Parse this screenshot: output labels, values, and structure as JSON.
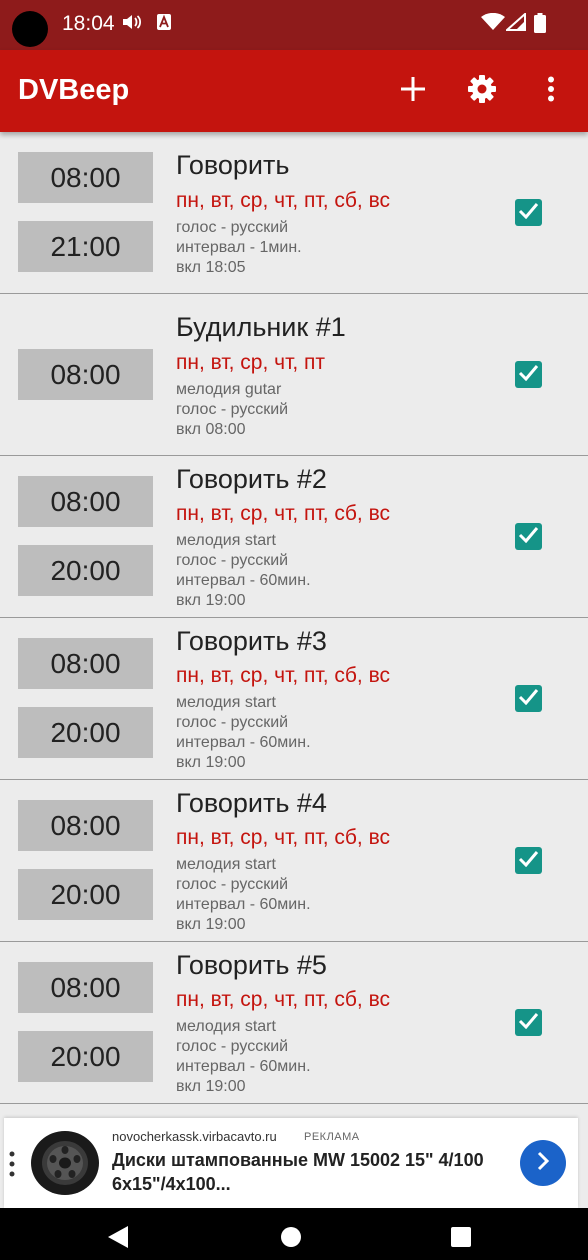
{
  "status_bar": {
    "time": "18:04",
    "icons": [
      "volume-icon",
      "notification-icon",
      "wifi-icon",
      "signal-icon",
      "battery-icon"
    ]
  },
  "app_bar": {
    "title": "DVBeep",
    "actions": [
      "add-icon",
      "settings-icon",
      "more-options-icon"
    ]
  },
  "items": [
    {
      "times": [
        "08:00",
        "21:00"
      ],
      "name": "Говорить",
      "days": "пн, вт, ср, чт, пт, сб, вс",
      "details": [
        "голос - русский",
        "интервал - 1мин.",
        "вкл 18:05"
      ],
      "checked": true
    },
    {
      "times": [
        "08:00"
      ],
      "name": "Будильник #1",
      "days": "пн, вт, ср, чт, пт",
      "details": [
        "мелодия gutar",
        "голос - русский",
        "вкл 08:00"
      ],
      "checked": true
    },
    {
      "times": [
        "08:00",
        "20:00"
      ],
      "name": "Говорить #2",
      "days": "пн, вт, ср, чт, пт, сб, вс",
      "details": [
        "мелодия start",
        "голос - русский",
        "интервал - 60мин.",
        "вкл 19:00"
      ],
      "checked": true
    },
    {
      "times": [
        "08:00",
        "20:00"
      ],
      "name": "Говорить #3",
      "days": "пн, вт, ср, чт, пт, сб, вс",
      "details": [
        "мелодия start",
        "голос - русский",
        "интервал - 60мин.",
        "вкл 19:00"
      ],
      "checked": true
    },
    {
      "times": [
        "08:00",
        "20:00"
      ],
      "name": "Говорить #4",
      "days": "пн, вт, ср, чт, пт, сб, вс",
      "details": [
        "мелодия start",
        "голос - русский",
        "интервал - 60мин.",
        "вкл 19:00"
      ],
      "checked": true
    },
    {
      "times": [
        "08:00",
        "20:00"
      ],
      "name": "Говорить #5",
      "days": "пн, вт, ср, чт, пт, сб, вс",
      "details": [
        "мелодия start",
        "голос - русский",
        "интервал - 60мин.",
        "вкл 19:00"
      ],
      "checked": true
    }
  ],
  "ad": {
    "domain": "novocherkassk.virbacavto.ru",
    "label": "РЕКЛАМА",
    "title_line1": "Диски штампованные MW 15002 15\" 4/100",
    "title_line2": "6x15\"/4x100...",
    "image": "wheel-rim-icon"
  },
  "nav_bar": [
    "back-icon",
    "home-icon",
    "recents-icon"
  ],
  "colors": {
    "status_bar": "#8e1b1b",
    "app_bar": "#c4140e",
    "days_text": "#c4140e",
    "checkbox": "#159488",
    "ad_button": "#1b63c9"
  }
}
